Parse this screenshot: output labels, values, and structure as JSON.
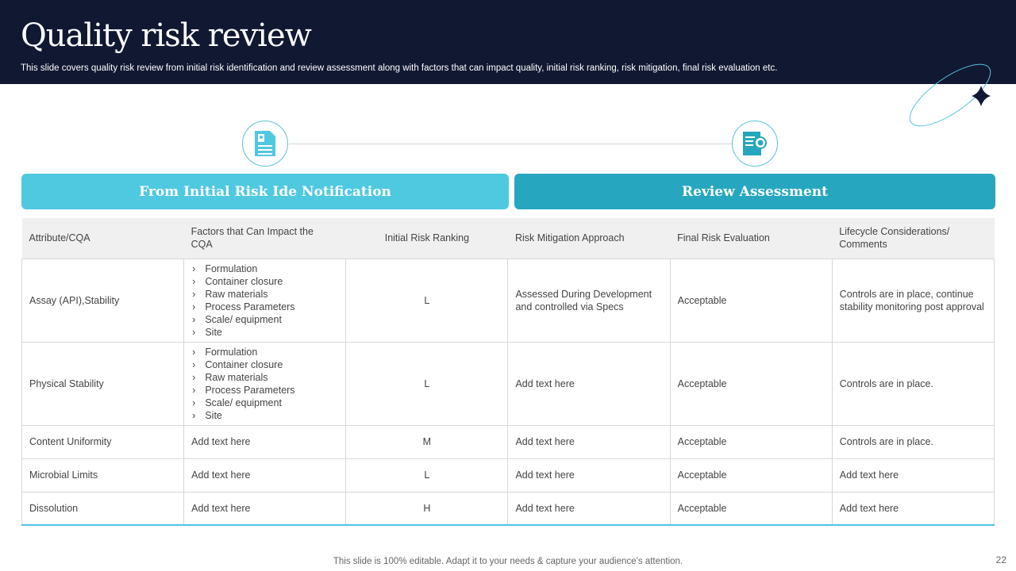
{
  "title": "Quality risk review",
  "subtitle": "This slide covers quality risk review from initial risk identification and review assessment along with factors that can impact quality, initial risk ranking, risk mitigation, final risk evaluation etc.",
  "bands": [
    "From Initial Risk Ide Notification",
    "Review Assessment"
  ],
  "colors": {
    "header": "#111832",
    "band_left": "#4fc9e0",
    "band_right": "#27a7bf"
  },
  "table": {
    "headers": [
      "Attribute/CQA",
      "Factors that Can Impact the CQA",
      "Initial Risk Ranking",
      "Risk Mitigation Approach",
      "Final Risk Evaluation",
      "Lifecycle Considerations/ Comments"
    ],
    "rows": [
      {
        "attr": "Assay (API),Stability",
        "factors": [
          "Formulation",
          "Container closure",
          "Raw materials",
          "Process Parameters",
          "Scale/ equipment",
          "Site"
        ],
        "rank": "L",
        "mitigation": "Assessed During Development and controlled via Specs",
        "final": "Acceptable",
        "comments": "Controls are in place, continue stability monitoring post approval"
      },
      {
        "attr": "Physical Stability",
        "factors": [
          "Formulation",
          "Container closure",
          "Raw materials",
          "Process Parameters",
          "Scale/ equipment",
          "Site"
        ],
        "rank": "L",
        "mitigation": "Add text here",
        "final": "Acceptable",
        "comments": "Controls are in place."
      },
      {
        "attr": "Content Uniformity",
        "factors_text": "Add text here",
        "rank": "M",
        "mitigation": "Add text here",
        "final": "Acceptable",
        "comments": "Controls are in place."
      },
      {
        "attr": "Microbial Limits",
        "factors_text": "Add text here",
        "rank": "L",
        "mitigation": "Add text here",
        "final": "Acceptable",
        "comments": "Add text here"
      },
      {
        "attr": "Dissolution",
        "factors_text": "Add text here",
        "rank": "H",
        "mitigation": "Add text here",
        "final": "Acceptable",
        "comments": "Add text here"
      }
    ]
  },
  "footer": "This slide is 100% editable. Adapt it to your needs & capture your audience’s attention.",
  "page_number": "22"
}
